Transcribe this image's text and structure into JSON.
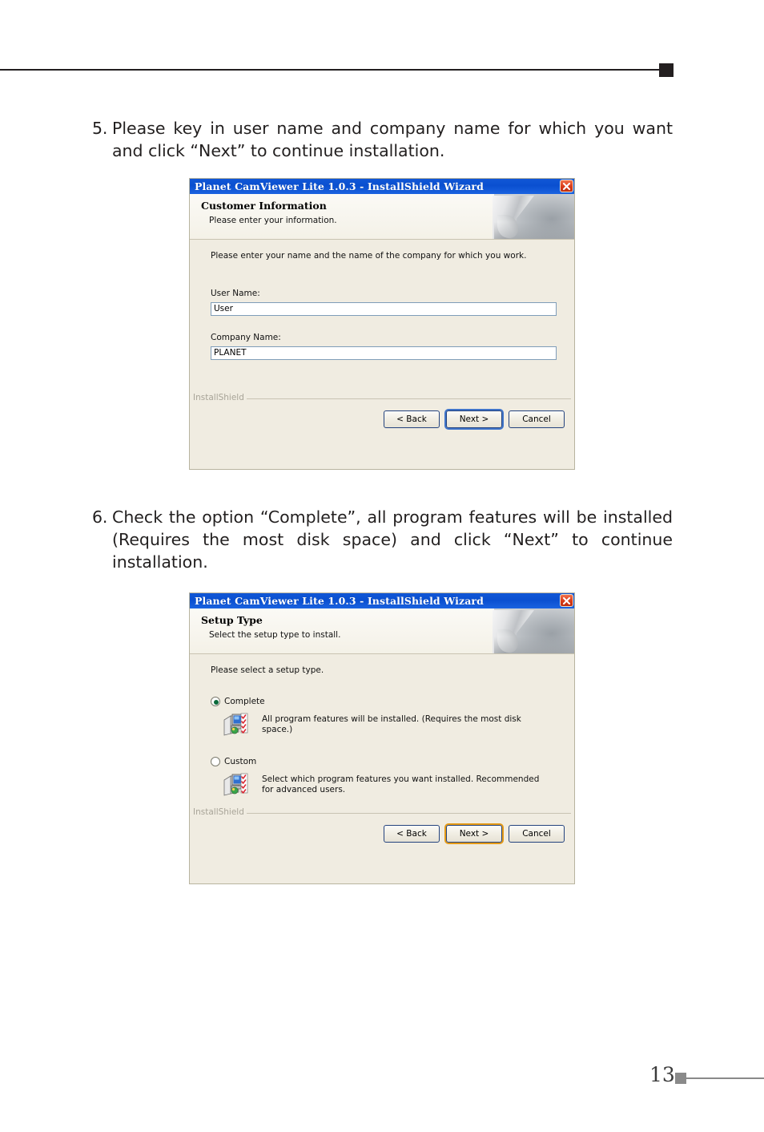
{
  "page": {
    "number": "13"
  },
  "steps": [
    {
      "number": "5.",
      "text": "Please key in user name and company name for which you want and click “Next” to continue installation."
    },
    {
      "number": "6.",
      "text": "Check the option “Complete”, all program features will be installed (Requires the most disk space) and click “Next” to continue installation."
    }
  ],
  "dialog1": {
    "title": "Planet CamViewer Lite 1.0.3 - InstallShield Wizard",
    "close_icon": "close-icon",
    "banner_title": "Customer Information",
    "banner_subtitle": "Please enter your information.",
    "intro": "Please enter your name and the name of the company for which you work.",
    "user_name_label": "User Name:",
    "user_name_value": "User",
    "company_name_label": "Company Name:",
    "company_name_value": "PLANET",
    "installshield_label": "InstallShield",
    "buttons": {
      "back": "< Back",
      "next": "Next >",
      "cancel": "Cancel"
    }
  },
  "dialog2": {
    "title": "Planet CamViewer Lite 1.0.3 - InstallShield Wizard",
    "close_icon": "close-icon",
    "banner_title": "Setup Type",
    "banner_subtitle": "Select the setup type to install.",
    "intro": "Please select a setup type.",
    "options": [
      {
        "label": "Complete",
        "selected": true,
        "description": "All program features will be installed. (Requires the most disk space.)",
        "icon": "setup-features-icon"
      },
      {
        "label": "Custom",
        "selected": false,
        "description": "Select which program features you want installed. Recommended for advanced users.",
        "icon": "setup-features-icon"
      }
    ],
    "installshield_label": "InstallShield",
    "buttons": {
      "back": "< Back",
      "next": "Next >",
      "cancel": "Cancel"
    }
  },
  "colors": {
    "titlebar": "#0a4fd0",
    "dialog_bg": "#f0ece1",
    "close_button": "#d93b18",
    "focus_blue": "#3f74c9",
    "hover_orange": "#e59a16",
    "rule_dark": "#231f20",
    "footer_gray": "#8a8a8a"
  }
}
